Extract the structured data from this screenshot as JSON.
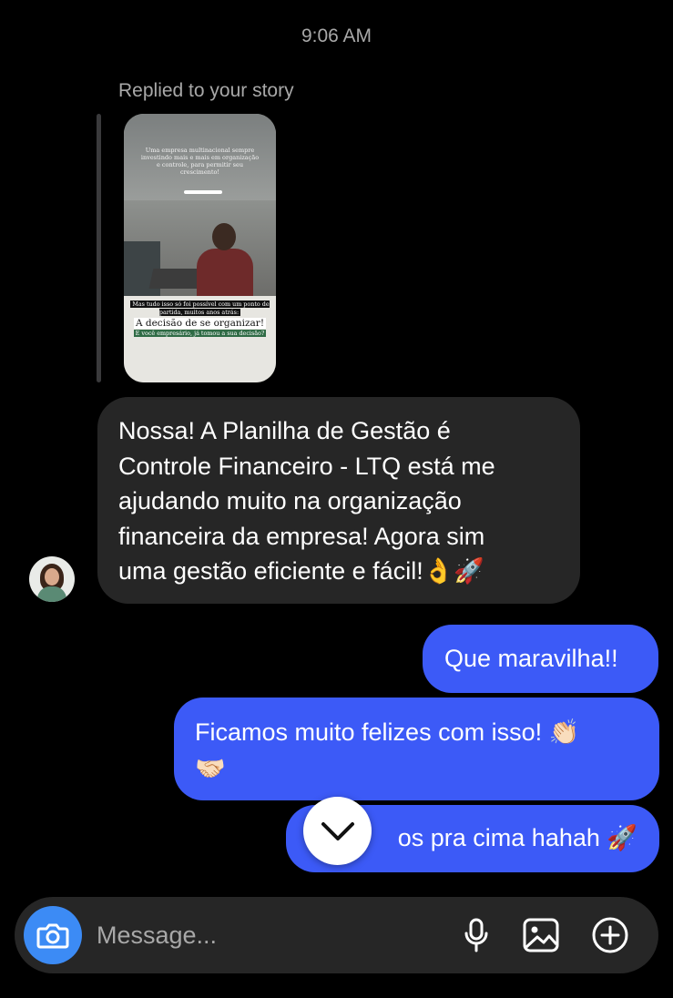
{
  "thread": {
    "timestamp": "9:06 AM",
    "reply_note": "Replied to your story"
  },
  "story": {
    "caption": "Uma empresa multinacional sempre investindo mais e mais em organização e controle, para permitir seu crescimento!",
    "line1": "Mas tudo isso só foi possível com um ponto de partida, muitos anos atrás:",
    "line2": "A decisão de se organizar!",
    "line3": "E você empresário, já tomou a sua decisão?"
  },
  "incoming": {
    "text": "Nossa! A Planilha de Gestão é\nControle Financeiro - LTQ  está me\najudando muito na organização\nfinanceira da empresa! Agora sim\numa gestão eficiente e fácil!👌🚀"
  },
  "outgoing": [
    {
      "text": "Que maravilha!!"
    },
    {
      "text": "Ficamos muito felizes com isso! 👏🏻\n🤝🏻"
    },
    {
      "text": "os pra cima hahah 🚀"
    }
  ],
  "composer": {
    "placeholder": "Message..."
  },
  "colors": {
    "background": "#000000",
    "incoming_bubble": "#262626",
    "outgoing_bubble": "#3c5af7",
    "camera_button": "#3c8bf5",
    "secondary_text": "#a8a8a8"
  },
  "icons": {
    "scroll_down": "chevron-down-icon",
    "camera": "camera-icon",
    "mic": "microphone-icon",
    "gallery": "image-icon",
    "more": "plus-circle-icon"
  }
}
